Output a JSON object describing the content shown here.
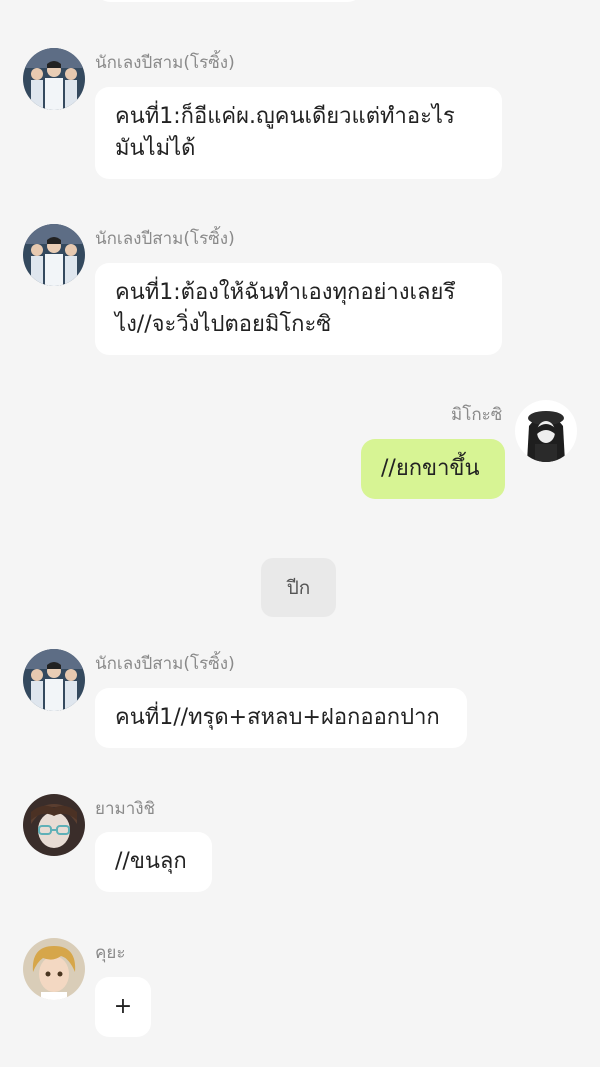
{
  "messages": [
    {
      "id": "m1",
      "sender": "นักเลงปีสาม(โรซิ้ง)",
      "text": "คนที่1:ก็อีแค่ผ.ญูคนเดียวแต่ทำอะไรมันไม่ได้",
      "outgoing": false,
      "avatar_icon": "avatar-group-icon"
    },
    {
      "id": "m2",
      "sender": "นักเลงปีสาม(โรซิ้ง)",
      "text": "คนที่1:ต้องให้ฉันทำเองทุกอย่างเลยรึไง//จะวิ่งไปตอยมิโกะซิ",
      "outgoing": false,
      "avatar_icon": "avatar-group-icon"
    },
    {
      "id": "m3",
      "sender": "มิโกะซิ",
      "text": "//ยกขาขึ้น",
      "outgoing": true,
      "avatar_icon": "avatar-girl-icon"
    },
    {
      "id": "m4",
      "sender": "นักเลงปีสาม(โรซิ้ง)",
      "text": "คนที่1//ทรุด+สหลบ+ฝอกออกปาก",
      "outgoing": false,
      "avatar_icon": "avatar-group-icon"
    },
    {
      "id": "m5",
      "sender": "ยามางิชิ",
      "text": "//ขนลุก",
      "outgoing": false,
      "avatar_icon": "avatar-glasses-icon"
    },
    {
      "id": "m6",
      "sender": "คุยะ",
      "text": "+",
      "outgoing": false,
      "avatar_icon": "avatar-blonde-icon"
    }
  ],
  "system_event": {
    "text": "ปีก"
  },
  "colors": {
    "background": "#f5f5f5",
    "incoming_bubble": "#ffffff",
    "outgoing_bubble": "#d7f494",
    "sender_text": "#8a8a8a",
    "system_pill": "#e9e9e9"
  }
}
